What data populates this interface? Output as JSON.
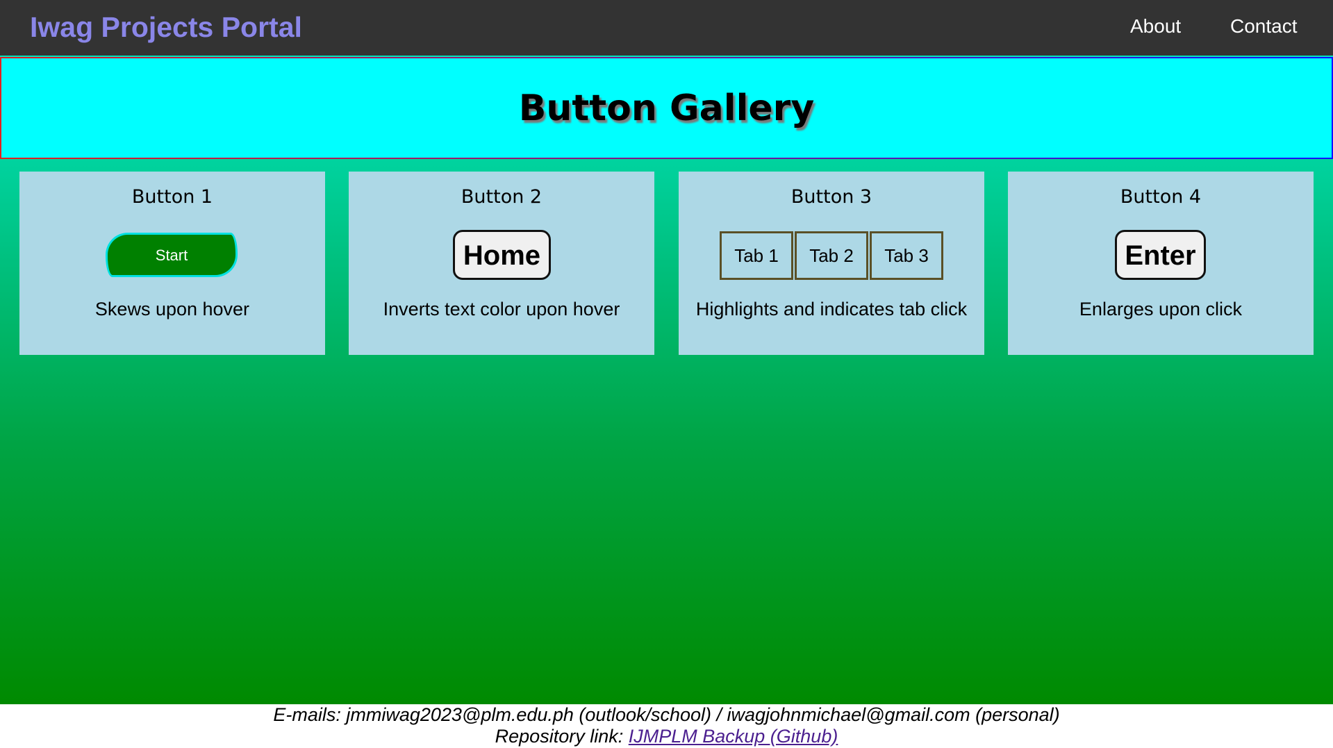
{
  "navbar": {
    "brand": "Iwag Projects Portal",
    "links": [
      "About",
      "Contact"
    ]
  },
  "banner": {
    "title": "Button Gallery"
  },
  "cards": [
    {
      "title": "Button 1",
      "button_label": "Start",
      "description": "Skews upon hover"
    },
    {
      "title": "Button 2",
      "button_label": "Home",
      "description": "Inverts text color upon hover"
    },
    {
      "title": "Button 3",
      "tabs": [
        "Tab 1",
        "Tab 2",
        "Tab 3"
      ],
      "description": "Highlights and indicates tab click"
    },
    {
      "title": "Button 4",
      "button_label": "Enter",
      "description": "Enlarges upon click"
    }
  ],
  "footer": {
    "emails_text": "E-mails: jmmiwag2023@plm.edu.ph (outlook/school) / iwagjohnmichael@gmail.com (personal)",
    "repo_prefix": "Repository link: ",
    "repo_link_text": "IJMPLM Backup (Github)"
  },
  "colors": {
    "navbar_bg": "#333333",
    "brand": "#8a86e8",
    "banner_bg": "#00ffff",
    "card_bg": "#add8e6",
    "start_button_bg": "#008000",
    "start_button_border": "#00e0e0",
    "gradient_top": "#00e6c0",
    "gradient_bottom": "#008a00",
    "link": "#4b1f8f"
  }
}
